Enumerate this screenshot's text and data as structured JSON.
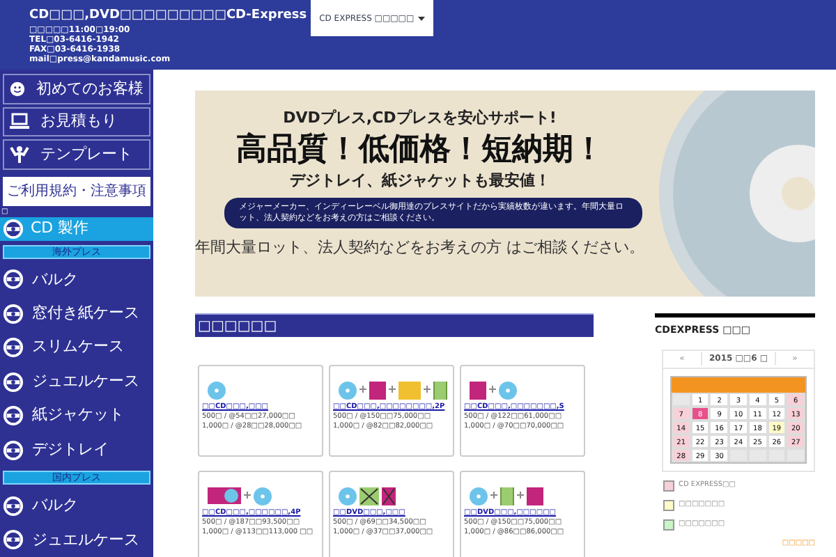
{
  "header": {
    "title": "CD□□□,DVD□□□□□□□□□CD-Express",
    "info": [
      "□□□□□11:00□19:00",
      "TEL□03-6416-1942",
      "FAX□03-6416-1938",
      "mail□press@kandamusic.com"
    ],
    "dropdown": "CD EXPRESS □□□□□"
  },
  "sidebar": {
    "buttons": [
      {
        "label": "初めてのお客様",
        "kind": "smiley"
      },
      {
        "label": "お見積もり",
        "kind": "laptop"
      },
      {
        "label": "テンプレート",
        "kind": "template"
      },
      {
        "label": "ご利用規約・注意事項",
        "kind": "plain"
      }
    ],
    "marker": "□",
    "menu": [
      {
        "kind": "heading",
        "label": "CD 製作",
        "selected": true
      },
      {
        "kind": "section",
        "label": "海外プレス"
      },
      {
        "kind": "item",
        "label": "バルク"
      },
      {
        "kind": "item",
        "label": "窓付き紙ケース"
      },
      {
        "kind": "item",
        "label": "スリムケース"
      },
      {
        "kind": "item",
        "label": "ジュエルケース"
      },
      {
        "kind": "item",
        "label": "紙ジャケット"
      },
      {
        "kind": "item",
        "label": "デジトレイ"
      },
      {
        "kind": "section",
        "label": "国内プレス"
      },
      {
        "kind": "item",
        "label": "バルク"
      },
      {
        "kind": "item",
        "label": "ジュエルケース"
      }
    ]
  },
  "banner": {
    "subtitle": "DVDプレス,CDプレスを安心サポート!",
    "headline": "高品質！低価格！短納期！",
    "tagline": "デジトレイ、紙ジャケットも最安値！",
    "notice": "メジャーメーカー、インディーレーベル御用達のプレスサイトだから実績枚数が違います。年間大量ロット、法人契約などをお考えの方はご相談ください。",
    "footer": "年間大量ロット、法人契約などをお考えの方 はご相談ください。"
  },
  "products": {
    "title": "□□□□□□",
    "cards": [
      {
        "icons": [
          {
            "kind": "disc"
          }
        ],
        "name": "□□CD□□□,□□□",
        "lines": [
          "500□ / @54□□27,000□□",
          "1,000□ / @28□□28,000□□"
        ]
      },
      {
        "icons": [
          {
            "kind": "disc"
          },
          {
            "kind": "plus"
          },
          {
            "kind": "case"
          },
          {
            "kind": "plus"
          },
          {
            "kind": "booklet"
          },
          {
            "kind": "plus"
          },
          {
            "kind": "tray"
          }
        ],
        "name": "□□CD□□□,□□□□□□□□,2P",
        "lines": [
          "500□ / @150□□75,000□□",
          "1,000□ / @82□□82,000□□"
        ]
      },
      {
        "icons": [
          {
            "kind": "case"
          },
          {
            "kind": "plus"
          },
          {
            "kind": "disc"
          }
        ],
        "name": "□□CD□□□,□□□□□□□,S",
        "lines": [
          "500□ / @122□□61,000□□",
          "1,000□ / @70□□70,000□□"
        ]
      },
      {
        "icons": [
          {
            "kind": "sleeve"
          },
          {
            "kind": "plus"
          },
          {
            "kind": "disc"
          }
        ],
        "name": "□□CD□□□,□□□□□□,4P",
        "lines": [
          "500□ / @187□□93,500□□",
          "1,000□ / @113□□113,000 □□"
        ]
      },
      {
        "icons": [
          {
            "kind": "disc"
          },
          {
            "kind": "cross-green"
          },
          {
            "kind": "cross-magenta"
          }
        ],
        "name": "□□DVD□□□,□□□",
        "lines": [
          "500□ / @69□□34,500□□",
          "1,000□ / @37□□37,000□□"
        ]
      },
      {
        "icons": [
          {
            "kind": "disc"
          },
          {
            "kind": "plus"
          },
          {
            "kind": "tray"
          },
          {
            "kind": "plus"
          },
          {
            "kind": "case"
          }
        ],
        "name": "□□DVD□□□,□□□□□□",
        "lines": [
          "500□ / @150□□75,000□□",
          "1,000□ / @86□□86,000□□"
        ]
      }
    ]
  },
  "calendar": {
    "title": "CDEXPRESS □□□",
    "prev": "«",
    "month": "2015 □□6 □",
    "next": "»",
    "weeks": [
      [
        {
          "kind": "blank"
        },
        {
          "day": "1",
          "kind": "normal"
        },
        {
          "day": "2",
          "kind": "normal"
        },
        {
          "day": "3",
          "kind": "normal"
        },
        {
          "day": "4",
          "kind": "normal"
        },
        {
          "day": "5",
          "kind": "normal"
        },
        {
          "day": "6",
          "kind": "holiday"
        }
      ],
      [
        {
          "day": "7",
          "kind": "holiday"
        },
        {
          "day": "8",
          "kind": "today"
        },
        {
          "day": "9",
          "kind": "normal"
        },
        {
          "day": "10",
          "kind": "normal"
        },
        {
          "day": "11",
          "kind": "normal"
        },
        {
          "day": "12",
          "kind": "normal"
        },
        {
          "day": "13",
          "kind": "holiday"
        }
      ],
      [
        {
          "day": "14",
          "kind": "holiday"
        },
        {
          "day": "15",
          "kind": "normal"
        },
        {
          "day": "16",
          "kind": "normal"
        },
        {
          "day": "17",
          "kind": "normal"
        },
        {
          "day": "18",
          "kind": "normal"
        },
        {
          "day": "19",
          "kind": "special"
        },
        {
          "day": "20",
          "kind": "holiday"
        }
      ],
      [
        {
          "day": "21",
          "kind": "holiday"
        },
        {
          "day": "22",
          "kind": "normal"
        },
        {
          "day": "23",
          "kind": "normal"
        },
        {
          "day": "24",
          "kind": "normal"
        },
        {
          "day": "25",
          "kind": "normal"
        },
        {
          "day": "26",
          "kind": "normal"
        },
        {
          "day": "27",
          "kind": "holiday"
        }
      ],
      [
        {
          "day": "28",
          "kind": "holiday"
        },
        {
          "day": "29",
          "kind": "normal"
        },
        {
          "day": "30",
          "kind": "normal"
        },
        {
          "kind": "blank"
        },
        {
          "kind": "blank"
        },
        {
          "kind": "blank"
        },
        {
          "kind": "blank"
        }
      ]
    ],
    "legend": [
      {
        "label": "CD EXPRESS□□",
        "color": "#f8d0d8"
      },
      {
        "label": "□□□□□□□",
        "color": "#fffbc8"
      },
      {
        "label": "□□□□□□□",
        "color": "#c8f5c8"
      }
    ],
    "link": "□□□□□"
  }
}
